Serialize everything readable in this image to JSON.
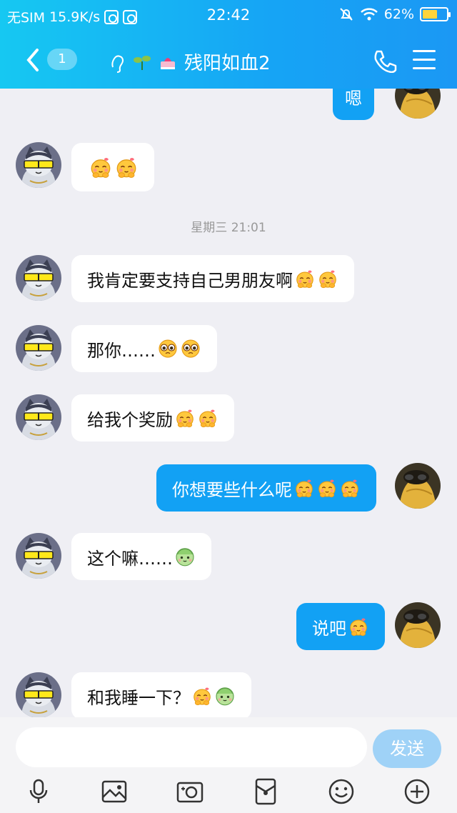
{
  "statusbar": {
    "carrier": "无SIM",
    "speed": "15.9K/s",
    "time": "22:42",
    "battery": "62%",
    "battery_level": 0.62
  },
  "header": {
    "unread_count": "1",
    "title": "残阳如血2"
  },
  "chat": {
    "timestamp": "星期三 21:01",
    "messages": [
      {
        "side": "out",
        "text": "嗯"
      },
      {
        "side": "in",
        "text": ""
      },
      {
        "side": "in",
        "text": "我肯定要支持自己男朋友啊"
      },
      {
        "side": "in",
        "text": "那你……"
      },
      {
        "side": "in",
        "text": "给我个奖励"
      },
      {
        "side": "out",
        "text": "你想要些什么呢"
      },
      {
        "side": "in",
        "text": "这个嘛……"
      },
      {
        "side": "out",
        "text": "说吧"
      },
      {
        "side": "in",
        "text": "和我睡一下？"
      }
    ]
  },
  "input": {
    "send_label": "发送"
  },
  "toolbar": [
    "microphone-icon",
    "image-icon",
    "camera-icon",
    "red-packet-icon",
    "emoji-icon",
    "plus-icon"
  ],
  "colors": {
    "header_start": "#16c8f2",
    "header_end": "#1b98f4",
    "bubble_out": "#12a1f4",
    "bubble_in": "#ffffff",
    "background": "#efeff4"
  }
}
